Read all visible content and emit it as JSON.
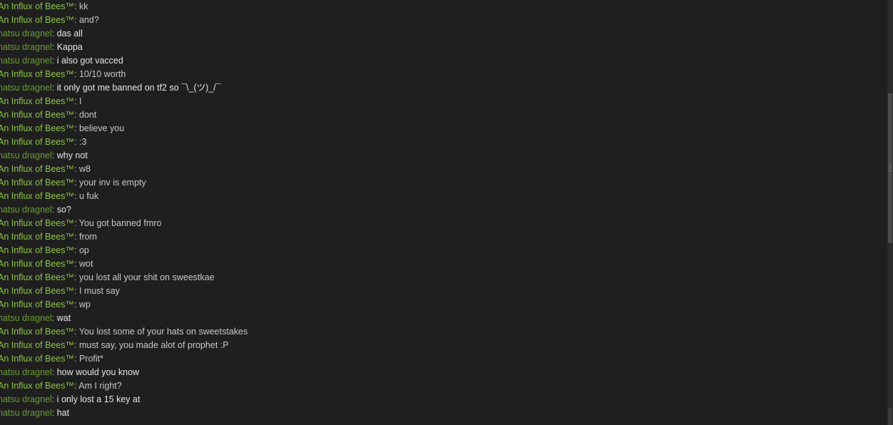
{
  "chat": {
    "messages": [
      {
        "sender": "An Influx of Bees™",
        "self": false,
        "text": "kk"
      },
      {
        "sender": "An Influx of Bees™",
        "self": false,
        "text": "and?"
      },
      {
        "sender": "natsu dragnel",
        "self": true,
        "text": "das all"
      },
      {
        "sender": "natsu dragnel",
        "self": true,
        "text": "Kappa"
      },
      {
        "sender": "natsu dragnel",
        "self": true,
        "text": "i also got vacced"
      },
      {
        "sender": "An Influx of Bees™",
        "self": false,
        "text": "10/10 worth"
      },
      {
        "sender": "natsu dragnel",
        "self": true,
        "text": "it only got me banned on tf2 so ¯\\_(ツ)_/¯"
      },
      {
        "sender": "An Influx of Bees™",
        "self": false,
        "text": "I"
      },
      {
        "sender": "An Influx of Bees™",
        "self": false,
        "text": "dont"
      },
      {
        "sender": "An Influx of Bees™",
        "self": false,
        "text": "believe you"
      },
      {
        "sender": "An Influx of Bees™",
        "self": false,
        "text": ":3"
      },
      {
        "sender": "natsu dragnel",
        "self": true,
        "text": "why not"
      },
      {
        "sender": "An Influx of Bees™",
        "self": false,
        "text": "w8"
      },
      {
        "sender": "An Influx of Bees™",
        "self": false,
        "text": "your inv is empty"
      },
      {
        "sender": "An Influx of Bees™",
        "self": false,
        "text": "u fuk"
      },
      {
        "sender": "natsu dragnel",
        "self": true,
        "text": "so?"
      },
      {
        "sender": "An Influx of Bees™",
        "self": false,
        "text": "You got banned fmro"
      },
      {
        "sender": "An Influx of Bees™",
        "self": false,
        "text": "from"
      },
      {
        "sender": "An Influx of Bees™",
        "self": false,
        "text": "op"
      },
      {
        "sender": "An Influx of Bees™",
        "self": false,
        "text": "wot"
      },
      {
        "sender": "An Influx of Bees™",
        "self": false,
        "text": "you lost all your shit on sweestkae"
      },
      {
        "sender": "An Influx of Bees™",
        "self": false,
        "text": "I must say"
      },
      {
        "sender": "An Influx of Bees™",
        "self": false,
        "text": "wp"
      },
      {
        "sender": "natsu dragnel",
        "self": true,
        "text": "wat"
      },
      {
        "sender": "An Influx of Bees™",
        "self": false,
        "text": "You lost some of your hats on sweetstakes"
      },
      {
        "sender": "An Influx of Bees™",
        "self": false,
        "text": "must say, you made alot of prophet :P"
      },
      {
        "sender": "An Influx of Bees™",
        "self": false,
        "text": "Profit*"
      },
      {
        "sender": "natsu dragnel",
        "self": true,
        "text": "how would you know"
      },
      {
        "sender": "An Influx of Bees™",
        "self": false,
        "text": "Am I right?"
      },
      {
        "sender": "natsu dragnel",
        "self": true,
        "text": "i only lost a 15 key at"
      },
      {
        "sender": "natsu dragnel",
        "self": true,
        "text": "hat"
      }
    ],
    "separator": ": "
  },
  "colors": {
    "background": "#1f1f1f",
    "friend_name": "#8bc53f",
    "self_name": "#6a9c31",
    "friend_text": "#c8c8c8",
    "self_text": "#e6e6e6"
  }
}
